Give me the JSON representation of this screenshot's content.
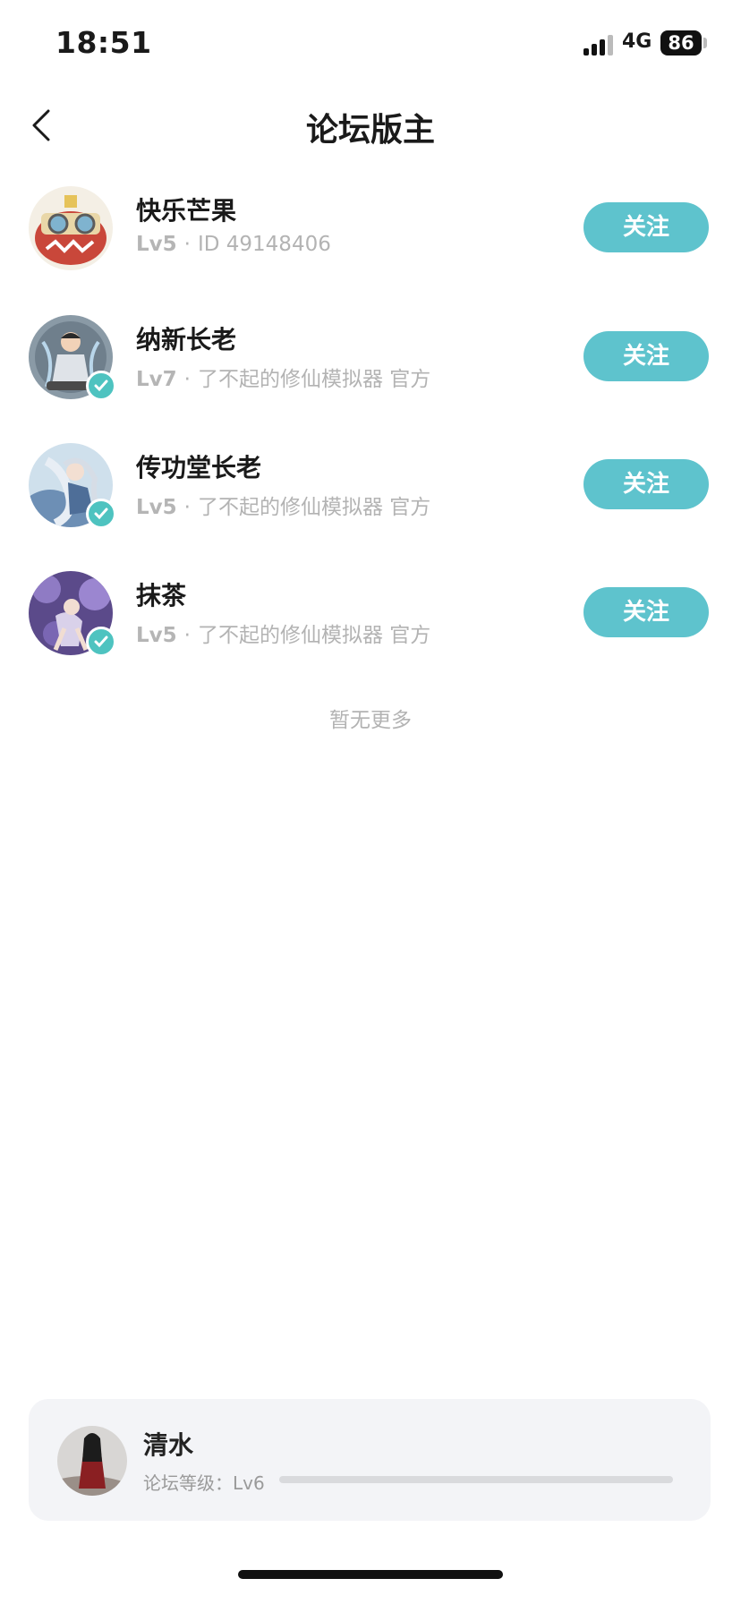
{
  "status": {
    "time": "18:51",
    "network": "4G",
    "battery": "86"
  },
  "nav": {
    "title": "论坛版主"
  },
  "moderators": [
    {
      "name": "快乐芒果",
      "level": "Lv5",
      "info": "ID 49148406",
      "follow_label": "关注",
      "verified": false
    },
    {
      "name": "纳新长老",
      "level": "Lv7",
      "info": "了不起的修仙模拟器 官方",
      "follow_label": "关注",
      "verified": true
    },
    {
      "name": "传功堂长老",
      "level": "Lv5",
      "info": "了不起的修仙模拟器 官方",
      "follow_label": "关注",
      "verified": true
    },
    {
      "name": "抹茶",
      "level": "Lv5",
      "info": "了不起的修仙模拟器 官方",
      "follow_label": "关注",
      "verified": true
    }
  ],
  "list_end": "暂无更多",
  "me": {
    "name": "清水",
    "level_label": "论坛等级：Lv6",
    "progress": 0
  },
  "colors": {
    "accent": "#5ec3cd",
    "verify": "#4ec3c0",
    "muted": "#b3b3b3"
  }
}
